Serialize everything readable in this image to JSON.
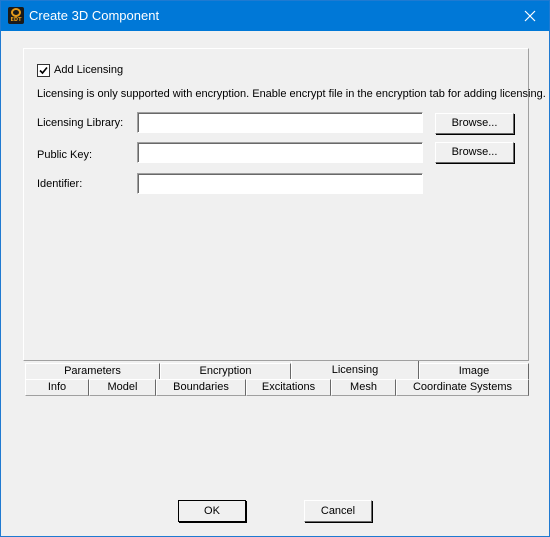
{
  "window": {
    "title": "Create 3D Component",
    "app_icon_text": "EDT",
    "close_glyph": "close-icon"
  },
  "licensing": {
    "add_licensing_label": "Add Licensing",
    "add_licensing_checked": true,
    "info_text": "Licensing is only supported with encryption. Enable encrypt file in the encryption tab for adding licensing.",
    "library_label": "Licensing Library:",
    "library_value": "",
    "public_key_label": "Public Key:",
    "public_key_value": "",
    "identifier_label": "Identifier:",
    "identifier_value": "",
    "browse_label": "Browse..."
  },
  "tabs_row_back": [
    "Parameters",
    "Encryption",
    "Licensing",
    "Image"
  ],
  "tabs_row_front": [
    "Info",
    "Model",
    "Boundaries",
    "Excitations",
    "Mesh",
    "Coordinate Systems"
  ],
  "active_tab": "Licensing",
  "footer": {
    "ok_label": "OK",
    "cancel_label": "Cancel"
  },
  "colors": {
    "titlebar": "#0078d7",
    "window_bg": "#f0f0f0",
    "icon_accent": "#e59a1a"
  }
}
